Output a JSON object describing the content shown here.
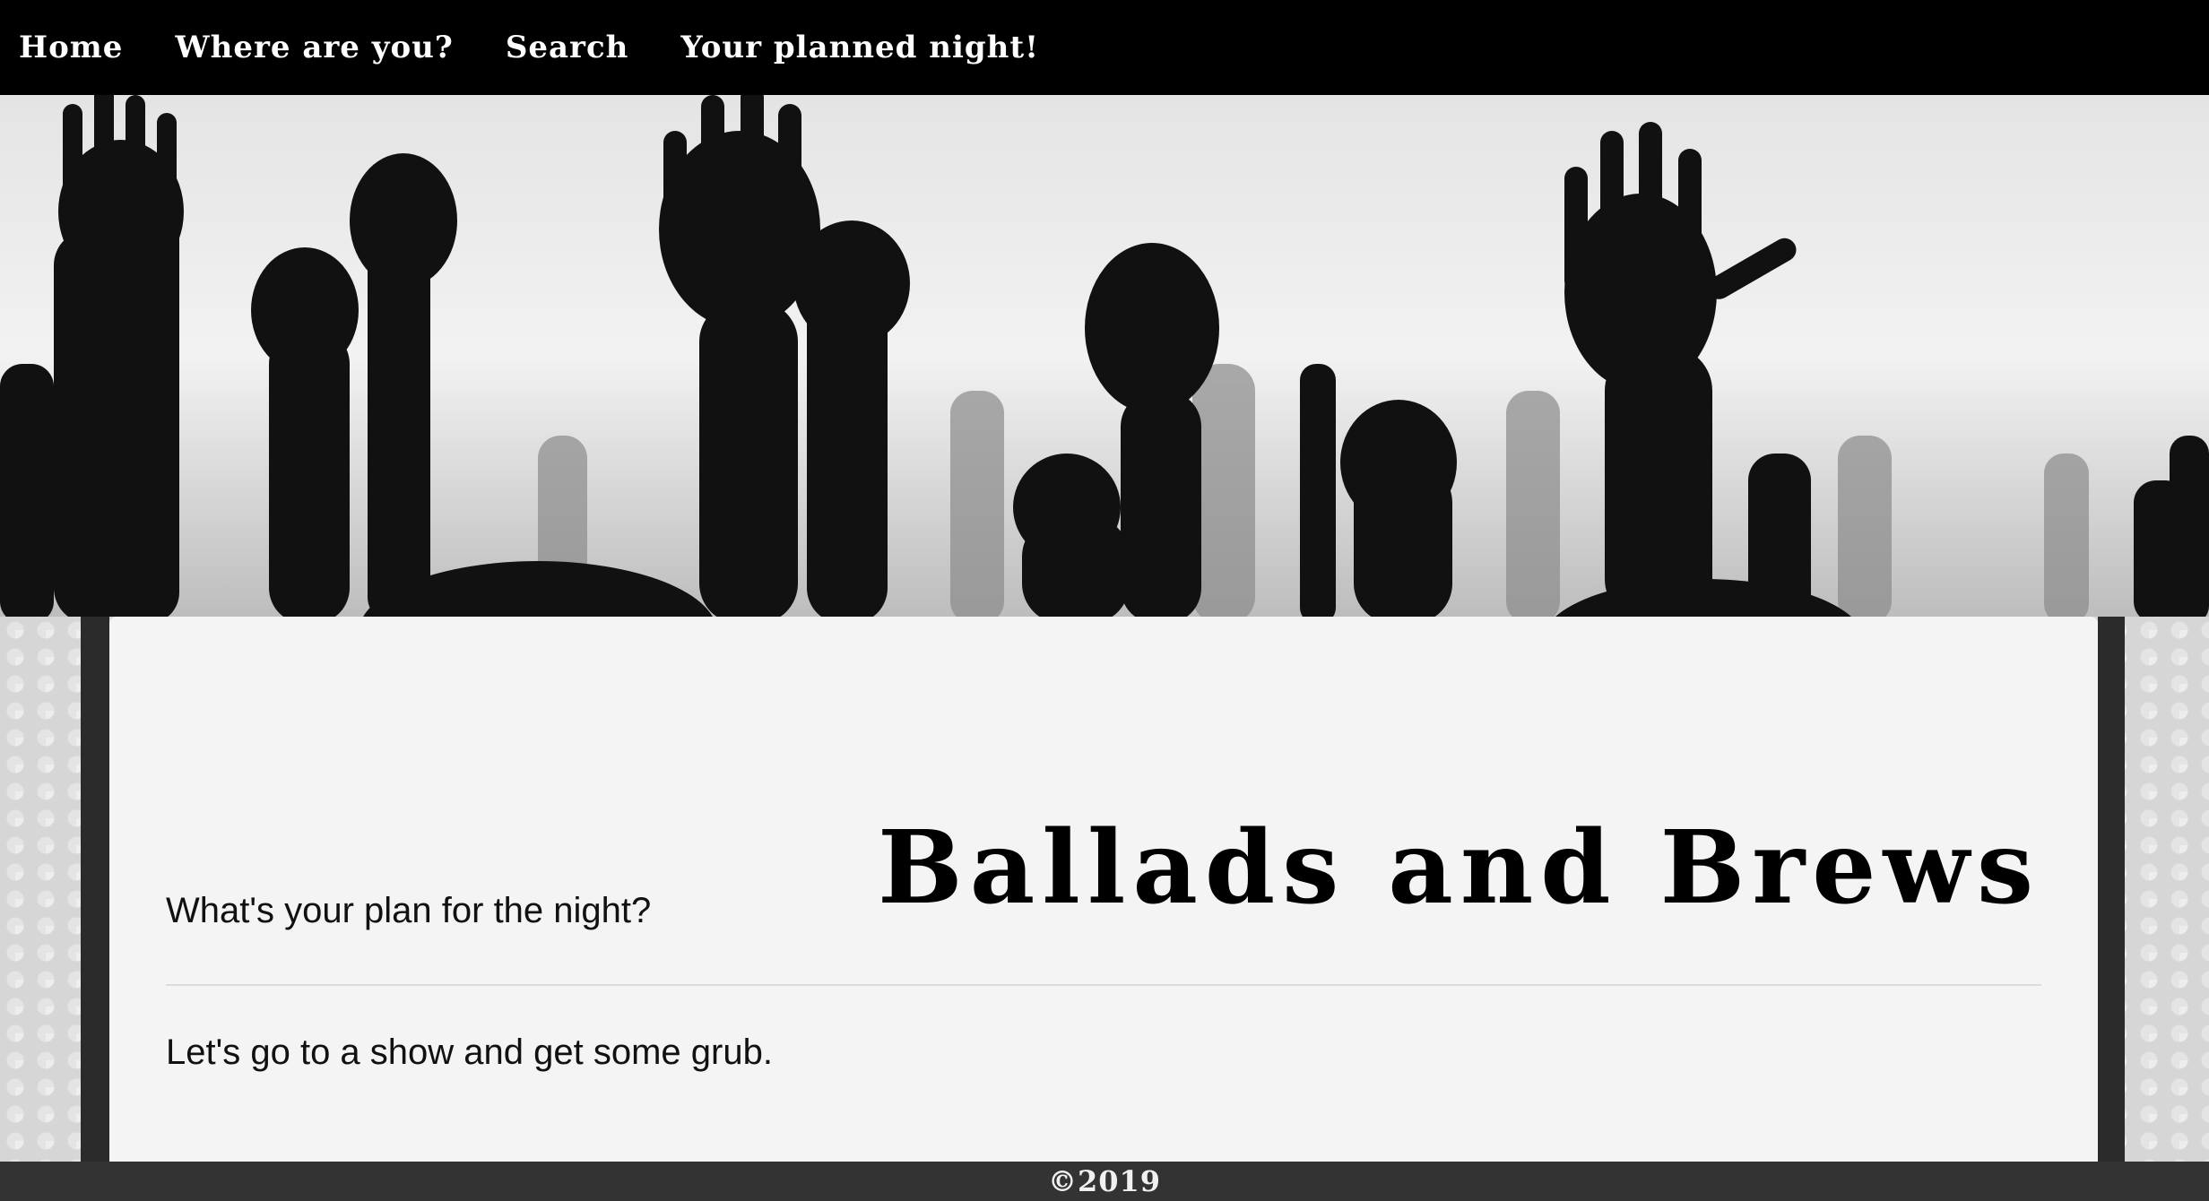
{
  "nav": {
    "items": [
      {
        "label": "Home"
      },
      {
        "label": "Where are you?"
      },
      {
        "label": "Search"
      },
      {
        "label": "Your planned night!"
      }
    ]
  },
  "hero": {
    "image": "raised-hands-concert-crowd"
  },
  "main": {
    "title": "Ballads and Brews",
    "question": "What's your plan for the night?",
    "answer": "Let's go to a show and get some grub."
  },
  "footer": {
    "copyright": "©2019"
  },
  "colors": {
    "nav_bg": "#000000",
    "card_bg": "#f4f4f4",
    "footer_bg": "#333333",
    "side_strip": "#2b2b2b"
  }
}
